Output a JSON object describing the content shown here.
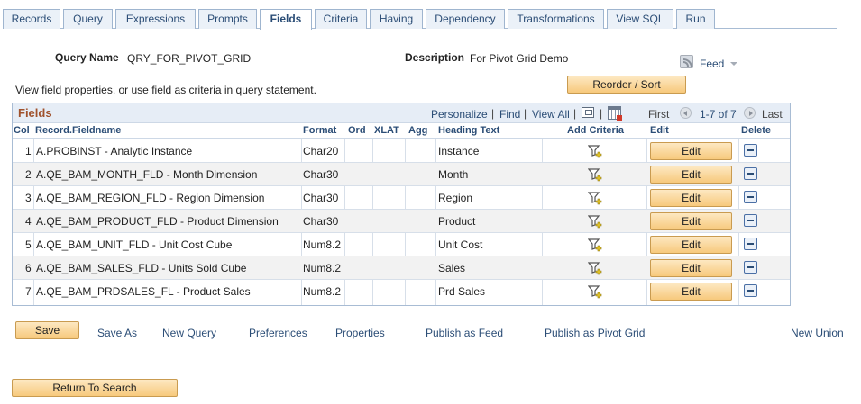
{
  "tabs": [
    "Records",
    "Query",
    "Expressions",
    "Prompts",
    "Fields",
    "Criteria",
    "Having",
    "Dependency",
    "Transformations",
    "View SQL",
    "Run"
  ],
  "query": {
    "name_label": "Query Name",
    "name_value": "QRY_FOR_PIVOT_GRID",
    "desc_label": "Description",
    "desc_value": "For Pivot Grid Demo"
  },
  "feed": {
    "label": "Feed",
    "icon": "rss-feed-icon"
  },
  "reorder_label": "Reorder / Sort",
  "hint": "View field properties, or use field as criteria in query statement.",
  "grid": {
    "title": "Fields",
    "personalize": "Personalize",
    "find": "Find",
    "view_all": "View All",
    "first": "First",
    "range": "1-7 of 7",
    "last": "Last",
    "columns": {
      "col": "Col",
      "field": "Record.Fieldname",
      "format": "Format",
      "ord": "Ord",
      "xlat": "XLAT",
      "agg": "Agg",
      "heading": "Heading Text",
      "add_criteria": "Add Criteria",
      "edit": "Edit",
      "delete": "Delete"
    },
    "edit_label": "Edit",
    "rows": [
      {
        "col": "1",
        "field": "A.PROBINST - Analytic Instance",
        "format": "Char20",
        "heading": "Instance"
      },
      {
        "col": "2",
        "field": "A.QE_BAM_MONTH_FLD - Month Dimension",
        "format": "Char30",
        "heading": "Month"
      },
      {
        "col": "3",
        "field": "A.QE_BAM_REGION_FLD - Region Dimension",
        "format": "Char30",
        "heading": "Region"
      },
      {
        "col": "4",
        "field": "A.QE_BAM_PRODUCT_FLD - Product Dimension",
        "format": "Char30",
        "heading": "Product"
      },
      {
        "col": "5",
        "field": "A.QE_BAM_UNIT_FLD - Unit Cost Cube",
        "format": "Num8.2",
        "heading": "Unit Cost"
      },
      {
        "col": "6",
        "field": "A.QE_BAM_SALES_FLD - Units Sold Cube",
        "format": "Num8.2",
        "heading": "Sales"
      },
      {
        "col": "7",
        "field": "A.QE_BAM_PRDSALES_FL - Product Sales",
        "format": "Num8.2",
        "heading": "Prd Sales"
      }
    ]
  },
  "actions": {
    "save": "Save",
    "save_as": "Save As",
    "new_query": "New Query",
    "preferences": "Preferences",
    "properties": "Properties",
    "publish_feed": "Publish as Feed",
    "publish_pivot": "Publish as Pivot Grid",
    "new_union": "New Union"
  },
  "return_label": "Return To Search",
  "colors": {
    "link": "#2b4d76",
    "grid_title": "#a0522d",
    "button": "#f7c97c"
  }
}
